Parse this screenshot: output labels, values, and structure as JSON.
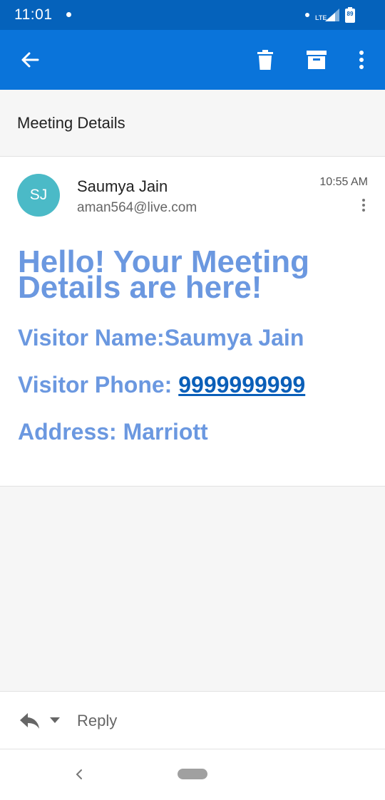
{
  "status_bar": {
    "time": "11:01",
    "network": "LTE",
    "battery": "89"
  },
  "app_bar": {
    "back_icon": "arrow-left-icon",
    "delete_icon": "trash-icon",
    "archive_icon": "archive-icon",
    "more_icon": "more-vertical-icon",
    "color": "#0a74da"
  },
  "subject": "Meeting Details",
  "message": {
    "avatar_initials": "SJ",
    "avatar_color": "#4bbac7",
    "sender_name": "Saumya Jain",
    "sender_email": "aman564@live.com",
    "time": "10:55 AM",
    "body": {
      "heading": "Hello! Your Meeting Details are here!",
      "visitor_name": "Visitor Name:Saumya Jain",
      "visitor_phone_label": "Visitor Phone: ",
      "visitor_phone_value": "9999999999",
      "address": "Address: Marriott",
      "text_color": "#6b98e0",
      "link_color": "#0a5fb8"
    }
  },
  "reply_bar": {
    "reply_label": "Reply"
  }
}
